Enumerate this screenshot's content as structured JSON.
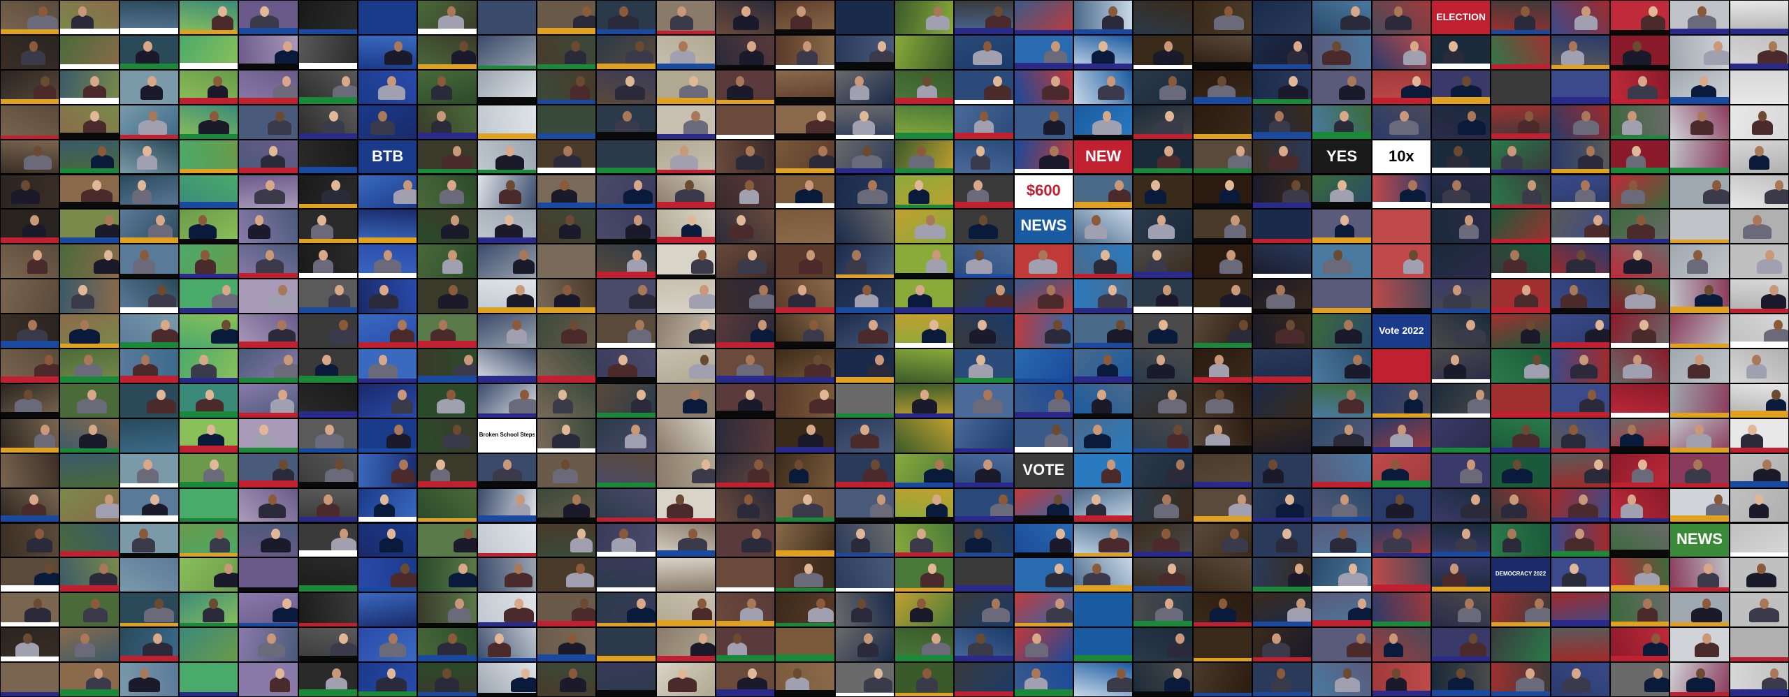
{
  "mosaic": {
    "columns": 30,
    "rows": 20,
    "background": "#050505",
    "column_palettes": [
      [
        "#3a2e25",
        "#5a4a3a",
        "#7a6650",
        "#2a2420"
      ],
      [
        "#4a6a3a",
        "#7a8a4a",
        "#3a5a6a",
        "#8a6a4a"
      ],
      [
        "#5a7a9a",
        "#3a6a8a",
        "#7a9aaa",
        "#2a4a5a"
      ],
      [
        "#6a9a4a",
        "#4aaa6a",
        "#8ac05a",
        "#3a8a7a"
      ],
      [
        "#6a5a8a",
        "#8a7aaa",
        "#4a5a7a",
        "#aa9aba"
      ],
      [
        "#1a1a1a",
        "#3a3a3a",
        "#2a2a2a",
        "#5a5a5a"
      ],
      [
        "#1a3a8a",
        "#2a4aaa",
        "#1a2a6a",
        "#3a6ac0"
      ],
      [
        "#2a4a2a",
        "#4a6a3a",
        "#3a3a2a",
        "#5a7a4a"
      ],
      [
        "#c0c8d0",
        "#9aa4b0",
        "#3a4a6a",
        "#e0e4e8"
      ],
      [
        "#4a3a2a",
        "#6a5a4a",
        "#3a4a3a",
        "#7a6a5a"
      ],
      [
        "#3a3a5a",
        "#4a4a6a",
        "#5a4a3a",
        "#2a3a4a"
      ],
      [
        "#d8d4c8",
        "#b0a890",
        "#8a7a6a",
        "#c8c0b0"
      ],
      [
        "#3a2a2a",
        "#5a3a3a",
        "#6a4a3a",
        "#2a2a3a"
      ],
      [
        "#5a3a2a",
        "#7a5a3a",
        "#3a2a1a",
        "#8a6a4a"
      ],
      [
        "#2a3a5a",
        "#4a5a7a",
        "#6a6a6a",
        "#1a2a4a"
      ],
      [
        "#3a5a2a",
        "#8aaa3a",
        "#c0a030",
        "#4a7a3a"
      ],
      [
        "#2a4a7a",
        "#1a3a6a",
        "#4a6a9a",
        "#3a3a3a"
      ],
      [
        "#1a4a9a",
        "#2a6ab0",
        "#c03a3a",
        "#3a5a8a"
      ],
      [
        "#1a5aa0",
        "#2a7ac0",
        "#c8d8e8",
        "#4a6a8a"
      ],
      [
        "#2a3a4a",
        "#3a2a1a",
        "#4a4a4a",
        "#1a2a3a"
      ],
      [
        "#3a2a1a",
        "#4a3a2a",
        "#2a1a10",
        "#5a4a3a"
      ],
      [
        "#1a2a4a",
        "#2a3a5a",
        "#3a2a1a",
        "#1a1a2a"
      ],
      [
        "#2a4a6a",
        "#4a7aa0",
        "#3a6a3a",
        "#5a5a7a"
      ],
      [
        "#a03a3a",
        "#c04a4a",
        "#2a3a6a",
        "#4a4a5a"
      ],
      [
        "#2a2a4a",
        "#3a3a6a",
        "#4a4a4a",
        "#1a2a3a"
      ],
      [
        "#1a5a3a",
        "#2a7a4a",
        "#3a3a3a",
        "#a03030"
      ],
      [
        "#2a3a6a",
        "#a02a2a",
        "#3a4a8a",
        "#5a5a5a"
      ],
      [
        "#8a1a2a",
        "#c02a3a",
        "#3a6a3a",
        "#6a6a6a"
      ],
      [
        "#c0c4c8",
        "#a0a8b0",
        "#8a3a5a",
        "#d0d4d8"
      ],
      [
        "#d8d8d8",
        "#c0c0c0",
        "#e8e8e8",
        "#b0b0b0"
      ]
    ],
    "ticker_colors": [
      "#1a4aa0",
      "#c02030",
      "#1a8a3a",
      "#e0a020",
      "#0a0a0a",
      "#2a2a8a",
      "#ffffff"
    ],
    "skin_tones": [
      "#c89878",
      "#a87858",
      "#d8a888",
      "#8a5a3a",
      "#e0b898",
      "#6a4a30"
    ],
    "clothing": [
      "#1a1a2a",
      "#2a2a3a",
      "#3a3a4a",
      "#4a2a2a",
      "#0a1a3a",
      "#6a6a7a",
      "#a0a0b0"
    ],
    "captions": [
      {
        "col": 24,
        "row": 0,
        "text": "ELECTION",
        "bg": "#c02030",
        "fg": "#ffffff"
      },
      {
        "col": 23,
        "row": 4,
        "text": "10x",
        "bg": "#ffffff",
        "fg": "#000000"
      },
      {
        "col": 17,
        "row": 6,
        "text": "NEWS",
        "bg": "#1a5aa0",
        "fg": "#ffffff"
      },
      {
        "col": 17,
        "row": 5,
        "text": "$600",
        "bg": "#ffffff",
        "fg": "#c02030"
      },
      {
        "col": 18,
        "row": 4,
        "text": "NEW",
        "bg": "#c02030",
        "fg": "#ffffff"
      },
      {
        "col": 6,
        "row": 4,
        "text": "BTB",
        "bg": "#1a3a8a",
        "fg": "#ffffff"
      },
      {
        "col": 22,
        "row": 4,
        "text": "YES",
        "bg": "#1a1a1a",
        "fg": "#ffffff"
      },
      {
        "col": 23,
        "row": 10,
        "text": "",
        "bg": "#c02030",
        "fg": "#ffffff"
      },
      {
        "col": 17,
        "row": 13,
        "text": "VOTE",
        "bg": "#3a3a3a",
        "fg": "#ffffff"
      },
      {
        "col": 8,
        "row": 12,
        "text": "Broken School Steps To",
        "bg": "#ffffff",
        "fg": "#000000"
      },
      {
        "col": 25,
        "row": 16,
        "text": "DEMOCRACY 2022",
        "bg": "#1a2a6a",
        "fg": "#ffffff"
      },
      {
        "col": 28,
        "row": 15,
        "text": "NEWS",
        "bg": "#3a8a3a",
        "fg": "#ffffff"
      },
      {
        "col": 23,
        "row": 9,
        "text": "Vote 2022",
        "bg": "#1a3a8a",
        "fg": "#ffffff"
      }
    ]
  }
}
